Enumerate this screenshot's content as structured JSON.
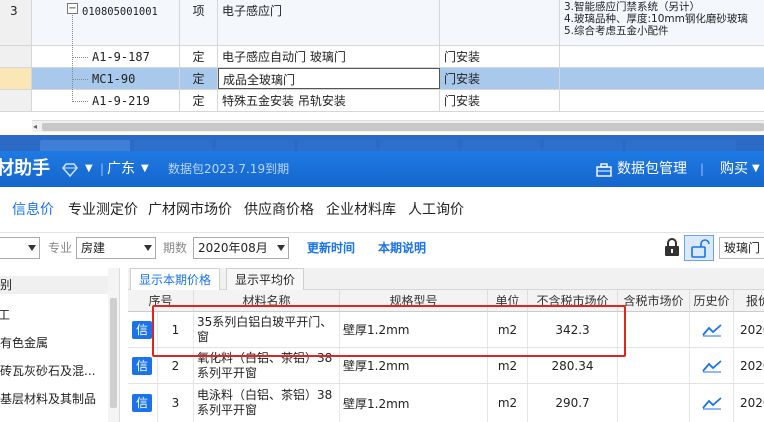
{
  "upper_grid": {
    "rows": [
      {
        "num": "3",
        "code": "010805001001",
        "type": "项",
        "name": "电子感应门",
        "work": "",
        "features": [
          "3.智能感应门禁系统（另计）",
          "4.玻璃品种、厚度:10mm钢化磨砂玻璃",
          "5.综合考虑五金小配件"
        ]
      },
      {
        "num": "",
        "code": "A1-9-187",
        "type": "定",
        "name": "电子感应自动门 玻璃门",
        "work": "门安装",
        "features": []
      },
      {
        "num": "",
        "code": "MC1-90",
        "type": "定",
        "name": "成品全玻璃门",
        "work": "门安装",
        "features": []
      },
      {
        "num": "",
        "code": "A1-9-219",
        "type": "定",
        "name": "特殊五金安装 吊轨安装",
        "work": "门安装",
        "features": []
      }
    ]
  },
  "app": {
    "title": "材助手",
    "region": "广东",
    "package_notice": "数据包2023.7.19到期",
    "package_manage": "数据包管理",
    "cart": "购买"
  },
  "menu": {
    "tabs": [
      "信息价",
      "专业测定价",
      "广材网市场价",
      "供应商价格",
      "企业材料库",
      "人工询价"
    ],
    "active_index": 0
  },
  "filters": {
    "specialty_label": "专业",
    "specialty_value": "房建",
    "period_label": "期数",
    "period_value": "2020年08月",
    "update_time": "更新时间",
    "period_desc": "本期说明",
    "search_value": "玻璃门"
  },
  "categories": {
    "items": [
      "别",
      "工",
      "有色金属",
      "砖瓦灰砂石及混...",
      "基层材料及其制品"
    ]
  },
  "price_tabs": {
    "tabs": [
      "显示本期价格",
      "显示平均价"
    ],
    "active_index": 0
  },
  "price_table": {
    "headers": [
      "序号",
      "材料名称",
      "规格型号",
      "单位",
      "不含税市场价",
      "含税市场价",
      "历史价",
      "报价"
    ],
    "badge": "信",
    "rows": [
      {
        "no": "1",
        "name": [
          "35系列白铝白玻平开门、",
          "窗"
        ],
        "spec": "壁厚1.2mm",
        "unit": "m2",
        "price": "342.3",
        "tax_price": "",
        "date": "2020"
      },
      {
        "no": "2",
        "name": [
          "氧化料（白铝、茶铝）38",
          "系列平开窗"
        ],
        "spec": "壁厚1.2mm",
        "unit": "m2",
        "price": "280.34",
        "tax_price": "",
        "date": "2020"
      },
      {
        "no": "3",
        "name": [
          "电泳料（白铝、茶铝）38",
          "系列平开窗"
        ],
        "spec": "壁厚1.2mm",
        "unit": "m2",
        "price": "290.7",
        "tax_price": "",
        "date": "2020"
      }
    ]
  },
  "colors": {
    "brand_blue": "#1a73e8",
    "titlebar_blue": "#1566cc",
    "selected_row": "#a8c8ec",
    "highlight_red": "#e02424"
  }
}
